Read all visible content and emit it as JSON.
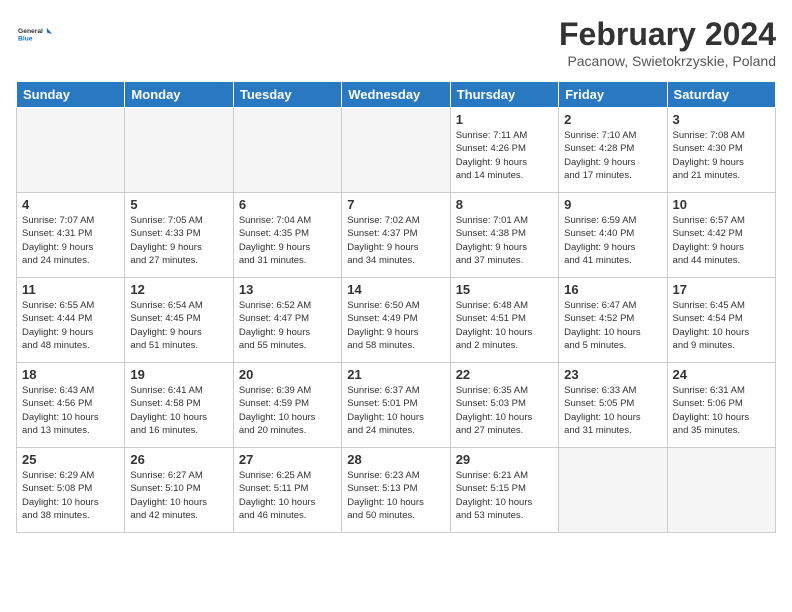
{
  "header": {
    "logo_line1": "General",
    "logo_line2": "Blue",
    "month": "February 2024",
    "location": "Pacanow, Swietokrzyskie, Poland"
  },
  "weekdays": [
    "Sunday",
    "Monday",
    "Tuesday",
    "Wednesday",
    "Thursday",
    "Friday",
    "Saturday"
  ],
  "weeks": [
    [
      {
        "day": "",
        "info": ""
      },
      {
        "day": "",
        "info": ""
      },
      {
        "day": "",
        "info": ""
      },
      {
        "day": "",
        "info": ""
      },
      {
        "day": "1",
        "info": "Sunrise: 7:11 AM\nSunset: 4:26 PM\nDaylight: 9 hours\nand 14 minutes."
      },
      {
        "day": "2",
        "info": "Sunrise: 7:10 AM\nSunset: 4:28 PM\nDaylight: 9 hours\nand 17 minutes."
      },
      {
        "day": "3",
        "info": "Sunrise: 7:08 AM\nSunset: 4:30 PM\nDaylight: 9 hours\nand 21 minutes."
      }
    ],
    [
      {
        "day": "4",
        "info": "Sunrise: 7:07 AM\nSunset: 4:31 PM\nDaylight: 9 hours\nand 24 minutes."
      },
      {
        "day": "5",
        "info": "Sunrise: 7:05 AM\nSunset: 4:33 PM\nDaylight: 9 hours\nand 27 minutes."
      },
      {
        "day": "6",
        "info": "Sunrise: 7:04 AM\nSunset: 4:35 PM\nDaylight: 9 hours\nand 31 minutes."
      },
      {
        "day": "7",
        "info": "Sunrise: 7:02 AM\nSunset: 4:37 PM\nDaylight: 9 hours\nand 34 minutes."
      },
      {
        "day": "8",
        "info": "Sunrise: 7:01 AM\nSunset: 4:38 PM\nDaylight: 9 hours\nand 37 minutes."
      },
      {
        "day": "9",
        "info": "Sunrise: 6:59 AM\nSunset: 4:40 PM\nDaylight: 9 hours\nand 41 minutes."
      },
      {
        "day": "10",
        "info": "Sunrise: 6:57 AM\nSunset: 4:42 PM\nDaylight: 9 hours\nand 44 minutes."
      }
    ],
    [
      {
        "day": "11",
        "info": "Sunrise: 6:55 AM\nSunset: 4:44 PM\nDaylight: 9 hours\nand 48 minutes."
      },
      {
        "day": "12",
        "info": "Sunrise: 6:54 AM\nSunset: 4:45 PM\nDaylight: 9 hours\nand 51 minutes."
      },
      {
        "day": "13",
        "info": "Sunrise: 6:52 AM\nSunset: 4:47 PM\nDaylight: 9 hours\nand 55 minutes."
      },
      {
        "day": "14",
        "info": "Sunrise: 6:50 AM\nSunset: 4:49 PM\nDaylight: 9 hours\nand 58 minutes."
      },
      {
        "day": "15",
        "info": "Sunrise: 6:48 AM\nSunset: 4:51 PM\nDaylight: 10 hours\nand 2 minutes."
      },
      {
        "day": "16",
        "info": "Sunrise: 6:47 AM\nSunset: 4:52 PM\nDaylight: 10 hours\nand 5 minutes."
      },
      {
        "day": "17",
        "info": "Sunrise: 6:45 AM\nSunset: 4:54 PM\nDaylight: 10 hours\nand 9 minutes."
      }
    ],
    [
      {
        "day": "18",
        "info": "Sunrise: 6:43 AM\nSunset: 4:56 PM\nDaylight: 10 hours\nand 13 minutes."
      },
      {
        "day": "19",
        "info": "Sunrise: 6:41 AM\nSunset: 4:58 PM\nDaylight: 10 hours\nand 16 minutes."
      },
      {
        "day": "20",
        "info": "Sunrise: 6:39 AM\nSunset: 4:59 PM\nDaylight: 10 hours\nand 20 minutes."
      },
      {
        "day": "21",
        "info": "Sunrise: 6:37 AM\nSunset: 5:01 PM\nDaylight: 10 hours\nand 24 minutes."
      },
      {
        "day": "22",
        "info": "Sunrise: 6:35 AM\nSunset: 5:03 PM\nDaylight: 10 hours\nand 27 minutes."
      },
      {
        "day": "23",
        "info": "Sunrise: 6:33 AM\nSunset: 5:05 PM\nDaylight: 10 hours\nand 31 minutes."
      },
      {
        "day": "24",
        "info": "Sunrise: 6:31 AM\nSunset: 5:06 PM\nDaylight: 10 hours\nand 35 minutes."
      }
    ],
    [
      {
        "day": "25",
        "info": "Sunrise: 6:29 AM\nSunset: 5:08 PM\nDaylight: 10 hours\nand 38 minutes."
      },
      {
        "day": "26",
        "info": "Sunrise: 6:27 AM\nSunset: 5:10 PM\nDaylight: 10 hours\nand 42 minutes."
      },
      {
        "day": "27",
        "info": "Sunrise: 6:25 AM\nSunset: 5:11 PM\nDaylight: 10 hours\nand 46 minutes."
      },
      {
        "day": "28",
        "info": "Sunrise: 6:23 AM\nSunset: 5:13 PM\nDaylight: 10 hours\nand 50 minutes."
      },
      {
        "day": "29",
        "info": "Sunrise: 6:21 AM\nSunset: 5:15 PM\nDaylight: 10 hours\nand 53 minutes."
      },
      {
        "day": "",
        "info": ""
      },
      {
        "day": "",
        "info": ""
      }
    ]
  ]
}
